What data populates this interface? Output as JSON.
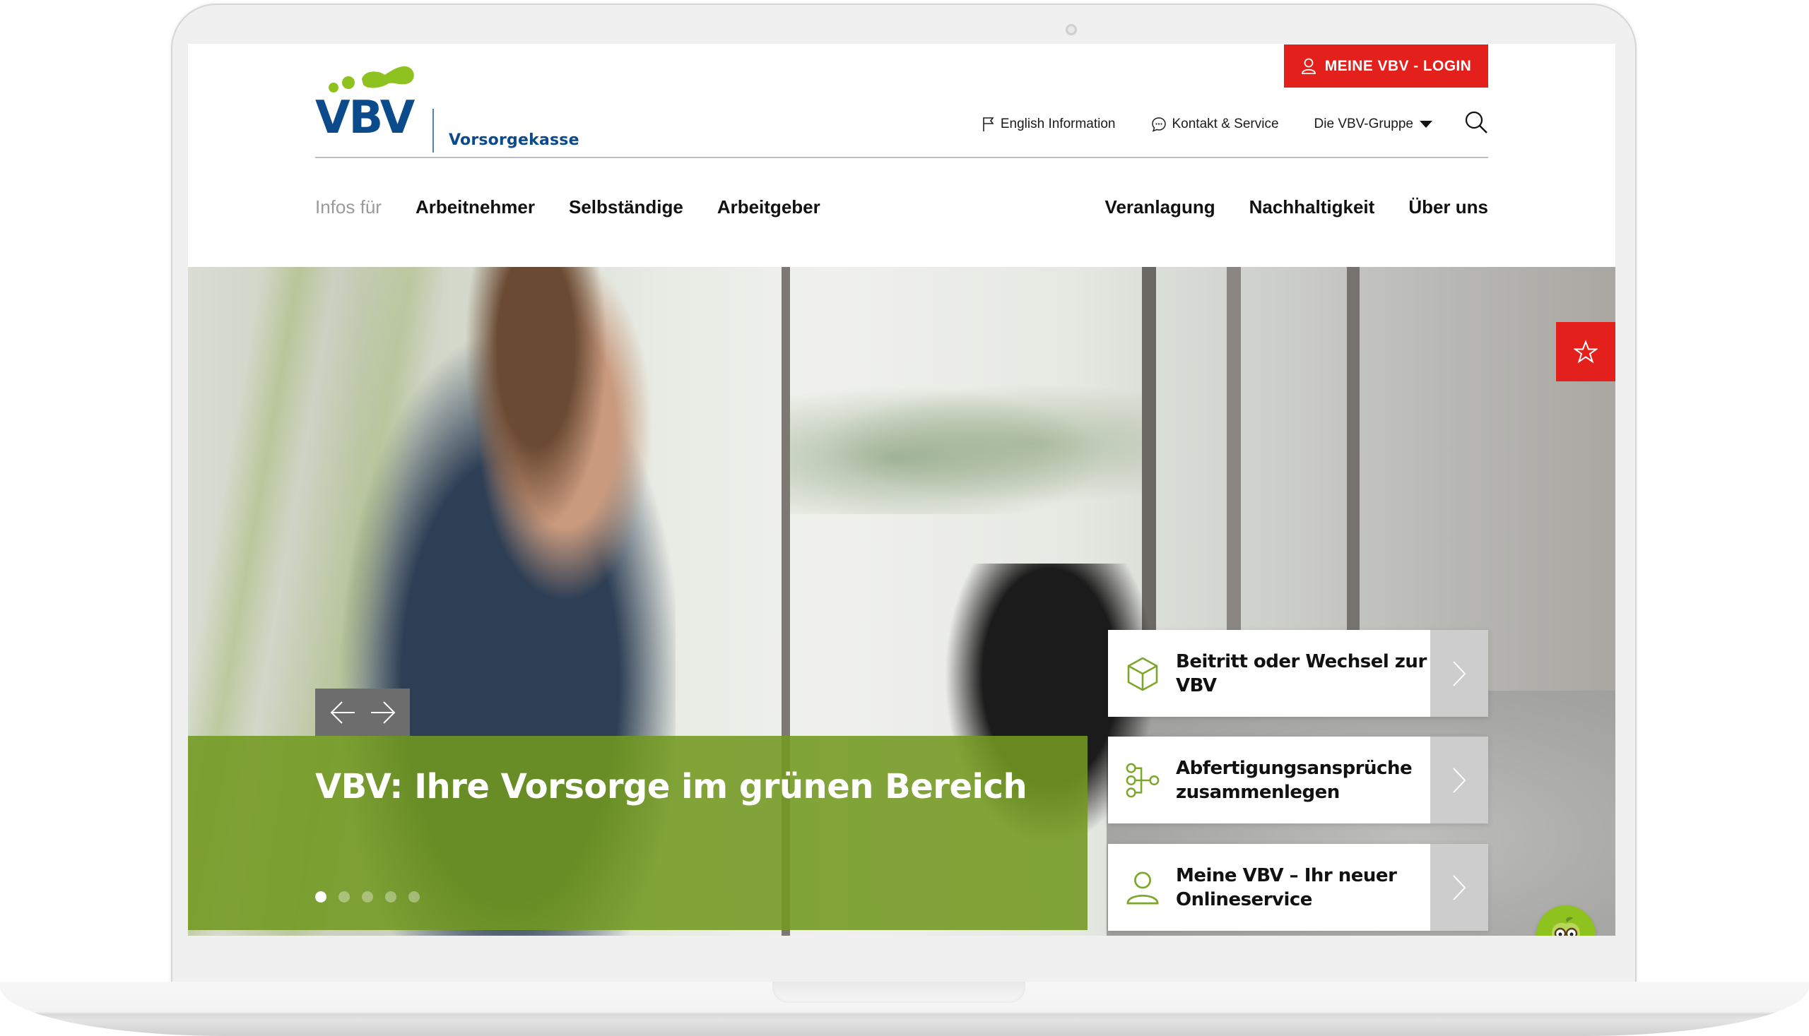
{
  "header": {
    "logo_text": "VBV",
    "logo_subtitle": "Vorsorgekasse",
    "login_button": {
      "label": "MEINE VBV - LOGIN",
      "icon": "user-icon",
      "color": "#e3201b"
    },
    "utility_nav": [
      {
        "label": "English Information",
        "icon": "flag-icon"
      },
      {
        "label": "Kontakt & Service",
        "icon": "chat-bubble-icon"
      },
      {
        "label": "Die VBV-Gruppe",
        "icon": "caret-down-icon"
      }
    ],
    "search_icon": "search-icon"
  },
  "main_nav": {
    "prefix_label": "Infos für",
    "left_items": [
      "Arbeitnehmer",
      "Selbständige",
      "Arbeitgeber"
    ],
    "right_items": [
      "Veranlagung",
      "Nachhaltigkeit",
      "Über uns"
    ]
  },
  "hero": {
    "title": "VBV: Ihre Vorsorge im grünen Bereich",
    "slider": {
      "prev_icon": "arrow-left-icon",
      "next_icon": "arrow-right-icon",
      "slide_count": 5,
      "active_slide": 1
    },
    "favorite_icon": "star-icon",
    "caption_color": "#729820",
    "cards": [
      {
        "line1": "Beitritt oder Wechsel zur",
        "line2": "VBV",
        "icon": "cube-icon"
      },
      {
        "line1": "Abfertigungsansprüche",
        "line2": "zusammenlegen",
        "icon": "merge-nodes-icon"
      },
      {
        "line1": "Meine VBV – Ihr neuer",
        "line2": "Onlineservice",
        "icon": "user-icon"
      }
    ],
    "chatbot_icon": "apple-mascot-icon"
  },
  "colors": {
    "brand_blue": "#0b4a8b",
    "brand_green": "#8dc21f",
    "accent_red": "#e3201b"
  }
}
